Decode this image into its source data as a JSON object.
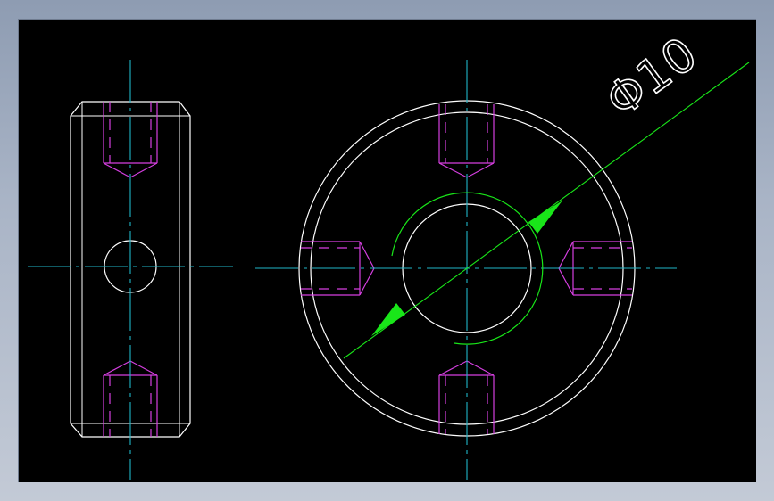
{
  "drawing": {
    "background": "#000000",
    "colors": {
      "outline": "#ffffff",
      "centerline": "#1fb6c8",
      "hidden_thread": "#d53fe0",
      "dimension": "#19e619"
    },
    "dimension": {
      "label": "Φ10",
      "value": 10,
      "unit": "mm"
    },
    "views": [
      "side-view",
      "front-view"
    ]
  }
}
